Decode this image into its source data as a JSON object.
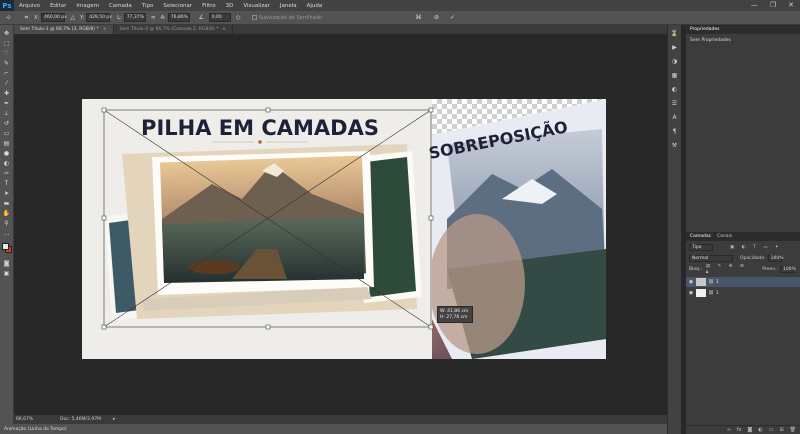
{
  "menu": {
    "logo": "Ps",
    "items": [
      "Arquivo",
      "Editar",
      "Imagem",
      "Camada",
      "Tipo",
      "Selecionar",
      "Filtro",
      "3D",
      "Visualizar",
      "Janela",
      "Ajuda"
    ]
  },
  "window_controls": {
    "minimize": "—",
    "restore": "❐",
    "close": "✕"
  },
  "options": {
    "x_label": "X:",
    "x_value": "460,00 px",
    "y_label": "Y:",
    "y_value": "429,50 px",
    "w_label": "L:",
    "w_value": "77,37%",
    "h_label": "A:",
    "h_value": "76,86%",
    "angle_value": "0,00",
    "interpolation_label": "Suavização de Serrilhado"
  },
  "tabs": [
    {
      "label": "Sem Título-1 @ 66,7% (3, RGB/8) *",
      "active": true
    },
    {
      "label": "Sem Título-2 @ 66,7% (Camada 2, RGB/8) *",
      "active": false
    }
  ],
  "artwork": {
    "title": "PILHA EM CAMADAS",
    "second_title": "SOBREPOSIÇÃO"
  },
  "measurement": {
    "w": "W: 41,86 cm",
    "h": "H: 27,76 cm"
  },
  "status": {
    "zoom": "66,67%",
    "doc": "Doc: 5,46M/3,97M"
  },
  "timeline_label": "Animação (Linha do Tempo)",
  "properties": {
    "tab": "Propriedades",
    "empty_text": "Sem Propriedades"
  },
  "layers_panel": {
    "tabs": [
      "Camadas",
      "Canais"
    ],
    "kind_label": "Tipo",
    "blend_mode": "Normal",
    "opacity_label": "Opacidade:",
    "opacity_value": "100%",
    "lock_label": "Bloq.:",
    "fill_label": "Preen.:",
    "fill_value": "100%",
    "layers": [
      {
        "name": "3",
        "selected": true
      },
      {
        "name": "1",
        "selected": false
      }
    ]
  },
  "colors": {
    "accent": "#d8401f",
    "selected_layer": "#48556a",
    "navy_text": "#1d2238"
  }
}
